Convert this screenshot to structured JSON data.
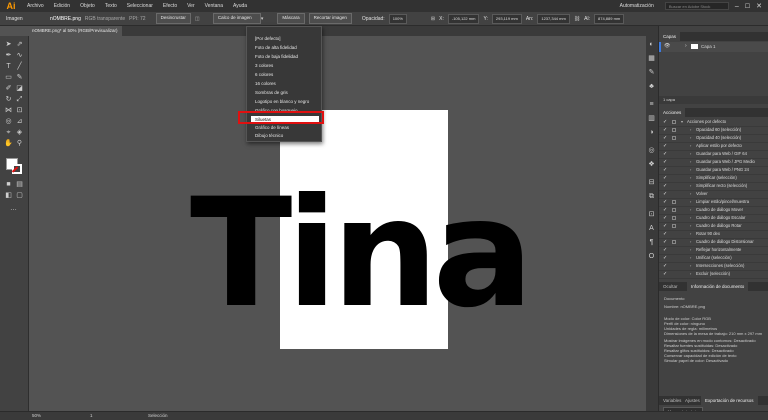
{
  "app": {
    "logo": "Ai"
  },
  "menu": [
    "Archivo",
    "Edición",
    "Objeto",
    "Texto",
    "Seleccionar",
    "Efecto",
    "Ver",
    "Ventana",
    "Ayuda"
  ],
  "workspace": "Automatización",
  "search_placeholder": "Buscar en Adobe Stock",
  "control_bar": {
    "mode_label": "Imagen",
    "file_info": "nOMBRE.png",
    "color_info": "RGB transparente",
    "ppi": "PPI: 72",
    "incrustar_btn": "Desincrustar",
    "preset_dropdown": "Calco de imagen",
    "mascara_btn": "Máscara",
    "recortar_btn": "Recortar imagen",
    "opacidad_label": "Opacidad:",
    "opacidad_value": "100%",
    "x_value": "-105,122 mm",
    "y_value": "293,119 mm",
    "w_value": "1237,344 mm",
    "h_value": "874,889 mm"
  },
  "document_tab": "nOMBRE.png* al 50% (RGB/Previsualizar)",
  "dropdown": {
    "items": [
      "[Por defecto]",
      "Foto de alta fidelidad",
      "Foto de baja fidelidad",
      "3 colores",
      "6 colores",
      "16 colores",
      "Sombras de gris",
      "Logotipo en blanco y negro",
      "Gráfico con bosquejo",
      "Siluetas",
      "Gráfico de líneas",
      "Dibujo técnico"
    ],
    "highlighted": "Siluetas"
  },
  "canvas_text": "Tina",
  "layers_panel": {
    "tab": "Capas",
    "layer_name": "Capa 1",
    "count": "1 capa"
  },
  "actions_panel": {
    "tab": "Acciones",
    "items": [
      "Acciones por defecto",
      "Opacidad 60 (selección)",
      "Opacidad 40 (selección)",
      "Aplicar estilo por defecto",
      "Guardar para Web / GIF 64",
      "Guardar para Web / JPG Medio",
      "Guardar para Web / PNG 24",
      "Simplificar (selección)",
      "Simplificar recto (selección)",
      "Volver",
      "Limpiar estilo/pincel/muestra",
      "Cuadro de diálogo Mover",
      "Cuadro de diálogo Escalar",
      "Cuadro de diálogo Rotar",
      "Rotar 90 dex",
      "Cuadro de diálogo Distorsionar",
      "Reflejar horizontalmente",
      "Unificar (selección)",
      "Intersecciones (selección)",
      "Excluir (selección)"
    ]
  },
  "info_panel": {
    "tabs": [
      "Ocultar",
      "Información de documento"
    ],
    "lines": [
      "Documento",
      "Nombre: nOMBRE.png",
      "Modo de color: Color RGB",
      "Perfil de color: ninguno",
      "Unidades de regla: milímetros",
      "Dimensiones de la mesa de trabajo: 210 mm x 297 mm",
      "Mostrar imágenes en modo contornos: Desactivado",
      "Resaltar fuentes sustituidas: Desactivado",
      "Resaltar glifos sustituidos: Desactivado",
      "Conservar capacidad de edición de texto",
      "Simular papel de color: Desactivado"
    ]
  },
  "bottom_tabs": [
    "Variables",
    "Ajustes",
    "Exportación de recursos"
  ],
  "workspace_btn": "Mesas de trabajo",
  "status": {
    "zoom": "50%",
    "page": "1",
    "tool": "Selección"
  }
}
